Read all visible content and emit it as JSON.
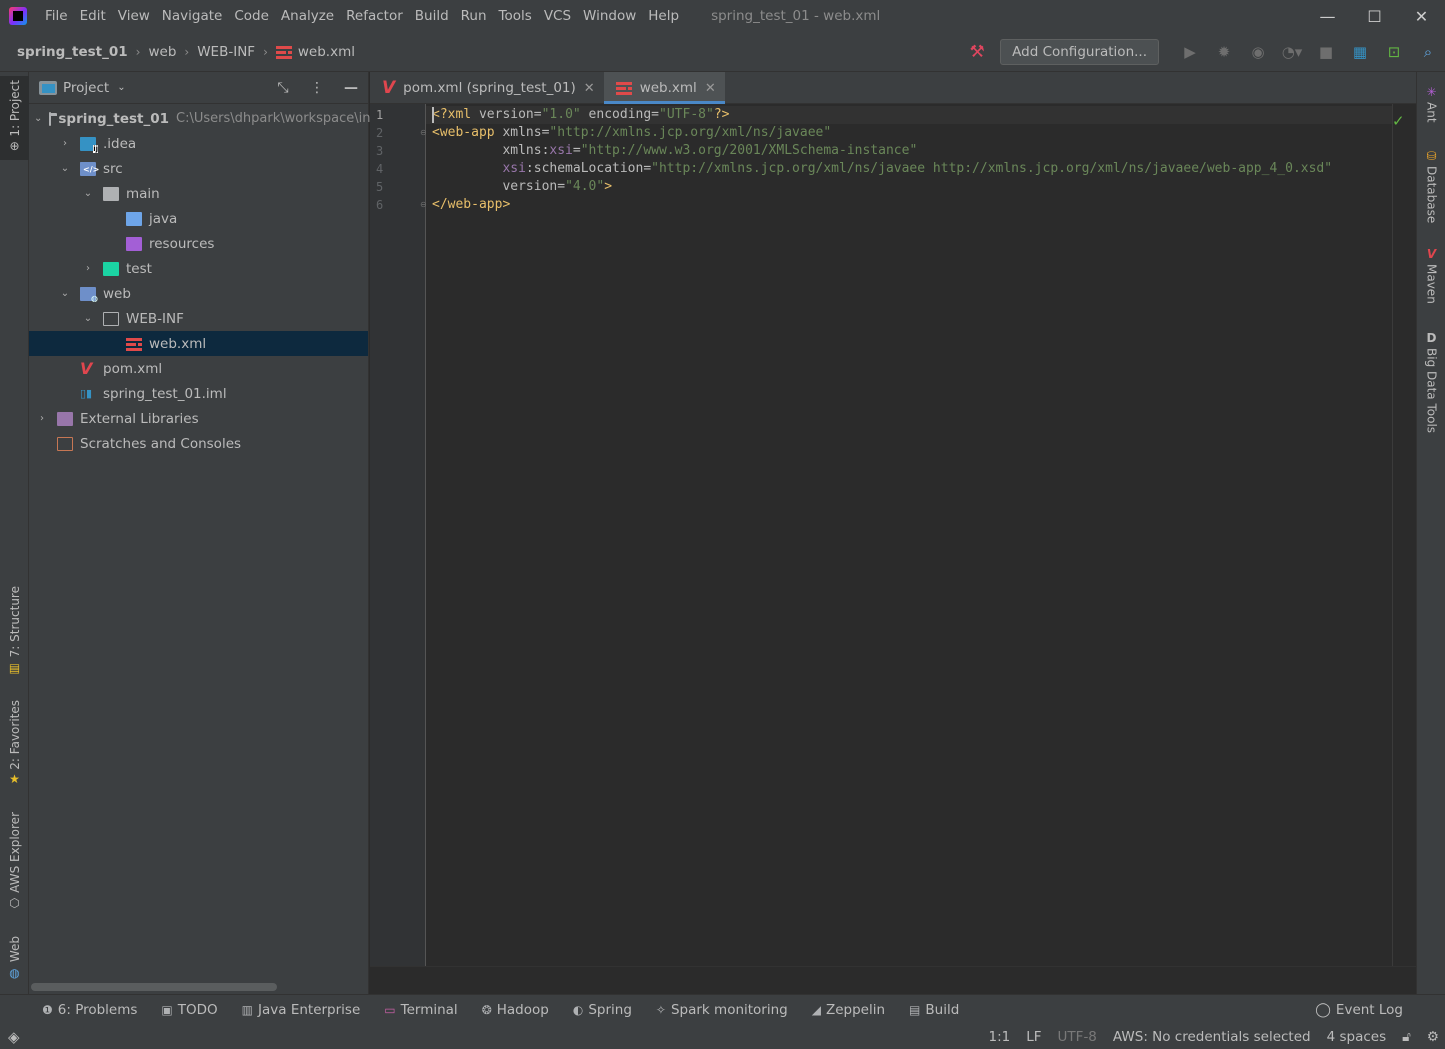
{
  "titlebar": {
    "menu": [
      "File",
      "Edit",
      "View",
      "Navigate",
      "Code",
      "Analyze",
      "Refactor",
      "Build",
      "Run",
      "Tools",
      "VCS",
      "Window",
      "Help"
    ],
    "window_title": "spring_test_01 - web.xml",
    "minimize": "—",
    "maximize": "☐",
    "close": "✕"
  },
  "breadcrumbs": [
    "spring_test_01",
    "web",
    "WEB-INF",
    "web.xml"
  ],
  "toolbar": {
    "add_configuration": "Add Configuration...",
    "icons": [
      "hammer-icon",
      "run-icon",
      "debug-icon",
      "coverage-icon",
      "profile-icon",
      "stop-icon",
      "layout-icon",
      "terminal-icon",
      "search-icon"
    ]
  },
  "left_tools": {
    "project": "1: Project",
    "structure": "7: Structure",
    "favorites": "2: Favorites",
    "aws": "AWS Explorer",
    "web": "Web"
  },
  "right_tools": {
    "ant": "Ant",
    "database": "Database",
    "maven": "Maven",
    "bigdata": "Big Data Tools"
  },
  "project_panel": {
    "title": "Project",
    "tree": [
      {
        "label": "spring_test_01",
        "path": "C:\\Users\\dhpark\\workspace\\in",
        "indent": 0,
        "chev": "⌄",
        "icon": "module",
        "bold": true
      },
      {
        "label": ".idea",
        "indent": 1,
        "chev": "›",
        "icon": "idea"
      },
      {
        "label": "src",
        "indent": 1,
        "chev": "⌄",
        "icon": "src"
      },
      {
        "label": "main",
        "indent": 2,
        "chev": "⌄",
        "icon": "plain"
      },
      {
        "label": "java",
        "indent": 3,
        "chev": "",
        "icon": "blue"
      },
      {
        "label": "resources",
        "indent": 3,
        "chev": "",
        "icon": "purple"
      },
      {
        "label": "test",
        "indent": 2,
        "chev": "›",
        "icon": "teal"
      },
      {
        "label": "web",
        "indent": 1,
        "chev": "⌄",
        "icon": "web"
      },
      {
        "label": "WEB-INF",
        "indent": 2,
        "chev": "⌄",
        "icon": "outline"
      },
      {
        "label": "web.xml",
        "indent": 3,
        "chev": "",
        "icon": "webxml",
        "selected": true
      },
      {
        "label": "pom.xml",
        "indent": 1,
        "chev": "",
        "icon": "maven"
      },
      {
        "label": "spring_test_01.iml",
        "indent": 1,
        "chev": "",
        "icon": "iml"
      },
      {
        "label": "External Libraries",
        "indent": 0,
        "chev": "›",
        "icon": "libs"
      },
      {
        "label": "Scratches and Consoles",
        "indent": 0,
        "chev": "",
        "icon": "scratch"
      }
    ]
  },
  "tabs": [
    {
      "label": "pom.xml (spring_test_01)",
      "active": false
    },
    {
      "label": "web.xml",
      "active": true
    }
  ],
  "editor": {
    "line_numbers": [
      "1",
      "2",
      "3",
      "4",
      "5",
      "6"
    ],
    "lines": [
      [
        {
          "t": "pi",
          "v": "<?xml "
        },
        {
          "t": "attr",
          "v": "version="
        },
        {
          "t": "str",
          "v": "\"1.0\""
        },
        {
          "t": "attr",
          "v": " encoding="
        },
        {
          "t": "str",
          "v": "\"UTF-8\""
        },
        {
          "t": "pi",
          "v": "?>"
        }
      ],
      [
        {
          "t": "tag",
          "v": "<web-app "
        },
        {
          "t": "attr",
          "v": "xmlns="
        },
        {
          "t": "str",
          "v": "\"http://xmlns.jcp.org/xml/ns/javaee\""
        }
      ],
      [
        {
          "t": "attr",
          "v": "         xmlns:"
        },
        {
          "t": "ns",
          "v": "xsi"
        },
        {
          "t": "attr",
          "v": "="
        },
        {
          "t": "str",
          "v": "\"http://www.w3.org/2001/XMLSchema-instance\""
        }
      ],
      [
        {
          "t": "ns",
          "v": "         xsi"
        },
        {
          "t": "attr",
          "v": ":schemaLocation="
        },
        {
          "t": "str",
          "v": "\"http://xmlns.jcp.org/xml/ns/javaee http://xmlns.jcp.org/xml/ns/javaee/web-app_4_0.xsd\""
        }
      ],
      [
        {
          "t": "attr",
          "v": "         version="
        },
        {
          "t": "str",
          "v": "\"4.0\""
        },
        {
          "t": "tag",
          "v": ">"
        }
      ],
      [
        {
          "t": "tag",
          "v": "</web-app>"
        }
      ]
    ]
  },
  "bottom_tools": [
    "6: Problems",
    "TODO",
    "Java Enterprise",
    "Terminal",
    "Hadoop",
    "Spring",
    "Spark monitoring",
    "Zeppelin",
    "Build"
  ],
  "event_log": "Event Log",
  "status": {
    "position": "1:1",
    "line_sep": "LF",
    "encoding": "UTF-8",
    "aws": "AWS: No credentials selected",
    "indent": "4 spaces"
  }
}
